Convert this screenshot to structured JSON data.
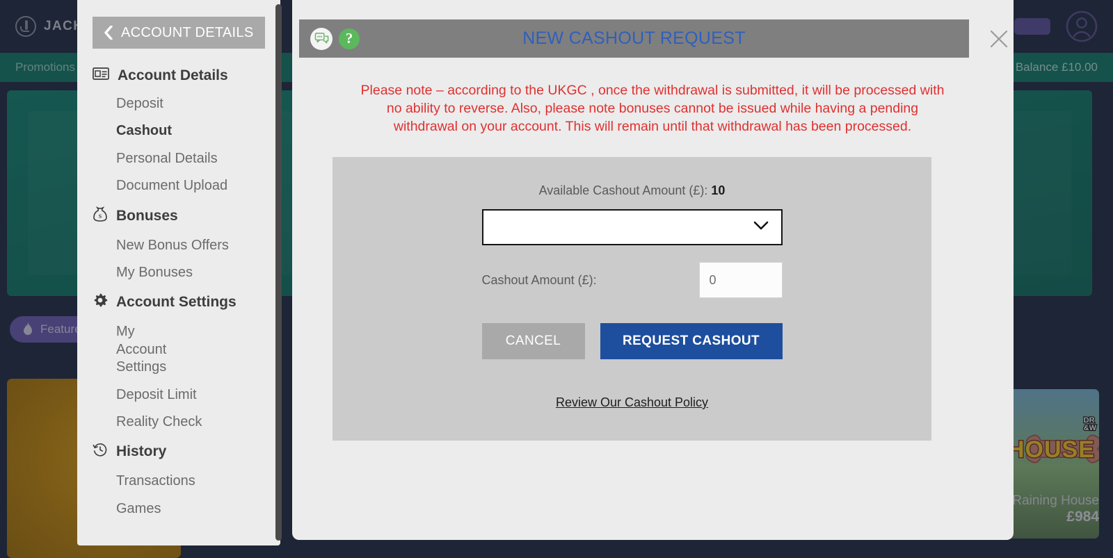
{
  "background": {
    "brand_name": "JACKIE JACKPOT",
    "brand_icon": "jackie-logo-icon",
    "top_button_label": "",
    "avatar_icon": "user-avatar-icon",
    "nav_left_label": "Promotions",
    "balance_label": "Balance £10.00",
    "featured_pill_label": "Featured",
    "featured_pill_icon": "flame-icon",
    "tile_right_title": "Raining House",
    "tile_right_amount": "£984",
    "tile_right_word": "HOUSE",
    "tile_right_badge": "DRAGONS\n& WILDS"
  },
  "sidebar": {
    "back_label": "ACCOUNT DETAILS",
    "back_icon": "chevron-left-icon",
    "groups": [
      {
        "label": "Account Details",
        "icon": "id-card-icon",
        "items": [
          {
            "label": "Deposit",
            "active": false
          },
          {
            "label": "Cashout",
            "active": true
          },
          {
            "label": "Personal Details",
            "active": false
          },
          {
            "label": "Document Upload",
            "active": false
          }
        ]
      },
      {
        "label": "Bonuses",
        "icon": "money-bag-icon",
        "items": [
          {
            "label": "New Bonus Offers",
            "active": false
          },
          {
            "label": "My Bonuses",
            "active": false
          }
        ]
      },
      {
        "label": "Account Settings",
        "icon": "gear-icon",
        "items": [
          {
            "label": "My Account Settings",
            "active": false
          },
          {
            "label": "Deposit Limit",
            "active": false
          },
          {
            "label": "Reality Check",
            "active": false
          }
        ]
      },
      {
        "label": "History",
        "icon": "clock-history-icon",
        "items": [
          {
            "label": "Transactions",
            "active": false
          },
          {
            "label": "Games",
            "active": false
          }
        ]
      }
    ]
  },
  "modal": {
    "title": "NEW CASHOUT REQUEST",
    "chat_icon": "chat-bubble-icon",
    "help_icon": "question-mark-icon",
    "help_label": "?",
    "close_icon": "close-icon",
    "warning_text": "Please note – according to the UKGC , once the withdrawal is submitted, it will be processed with no ability to reverse. Also, please note bonuses cannot be issued while having a pending withdrawal on your account. This will remain until that withdrawal has been processed.",
    "available_label": "Available Cashout Amount (£):",
    "available_value": "10",
    "method_select": {
      "selected_value": "",
      "dropdown_icon": "chevron-down-icon",
      "options": []
    },
    "amount_label": "Cashout Amount (£):",
    "amount_value": "",
    "amount_placeholder": "0",
    "cancel_label": "CANCEL",
    "request_label": "REQUEST CASHOUT",
    "policy_link_label": "Review Our Cashout Policy"
  },
  "colors": {
    "modal_title_blue": "#2f5fbd",
    "warning_red": "#e03030",
    "primary_button_blue": "#1e4f9e",
    "cancel_gray": "#a9a9a9",
    "header_gray": "#7f7f7f",
    "panel_gray": "#cbcbcb",
    "brand_navy": "#1d2943",
    "brand_green": "#0c7a66",
    "featured_purple": "#6a5cb5"
  }
}
